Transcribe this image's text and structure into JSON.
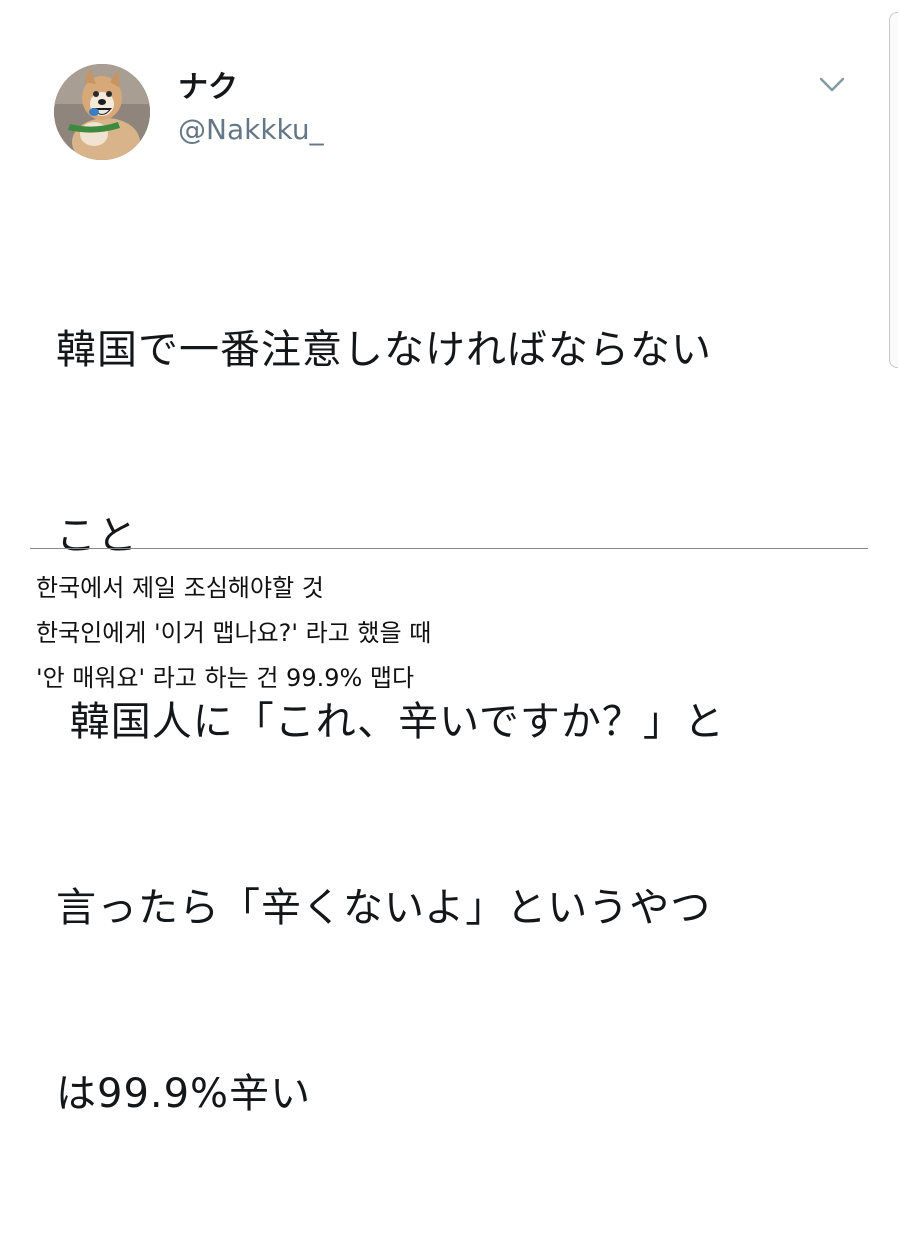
{
  "tweet": {
    "display_name": "ナク",
    "handle": "@Nakkku_",
    "avatar": "avatar-dog-photo",
    "menu_icon": "chevron-down-icon",
    "text_lines": [
      "韓国で一番注意しなければならない",
      "こと",
      " 韓国人に「これ、辛いですか？」と",
      "言ったら「辛くないよ」というやつ",
      "は99.9%辛い"
    ]
  },
  "translation": {
    "lines": [
      "한국에서 제일 조심해야할 것",
      "한국인에게 '이거 맵나요?' 라고 했을 때",
      "'안 매워요' 라고 하는 건 99.9% 맵다"
    ]
  },
  "colors": {
    "text": "#14171a",
    "handle": "#657786",
    "divider": "#8a8a8a",
    "background": "#ffffff"
  }
}
